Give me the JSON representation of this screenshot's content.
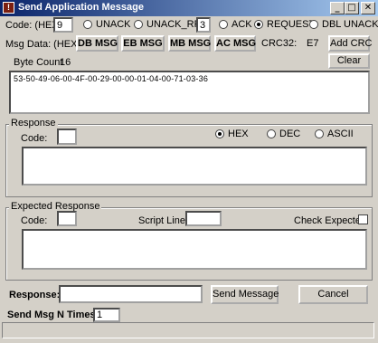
{
  "window": {
    "title": "Send Application Message",
    "app_icon_glyph": "!",
    "minimize_glyph": "_",
    "maximize_glyph": "□",
    "close_glyph": "✕"
  },
  "code": {
    "label": "Code: (HEX)",
    "value": "9"
  },
  "msg_type": {
    "unack": "UNACK",
    "unack_rpt": "UNACK_RPT",
    "rpt_count": "3",
    "ack": "ACK",
    "request": "REQUEST",
    "dbl_unack": "DBL UNACK",
    "selected": "REQUEST"
  },
  "msg_data": {
    "label": "Msg Data: (HEX)",
    "db_msg": "DB MSG",
    "eb_msg": "EB MSG",
    "mb_msg": "MB MSG",
    "ac_msg": "AC MSG",
    "crc_label": "CRC32:",
    "crc_value": "E7",
    "add_crc": "Add CRC",
    "byte_count_label": "Byte Count",
    "byte_count_value": "16",
    "clear": "Clear",
    "data_text": "53-50-49-06-00-4F-00-29-00-00-01-04-00-71-03-36"
  },
  "response_group": {
    "title": "Response",
    "code_label": "Code:",
    "code_value": "",
    "hex": "HEX",
    "dec": "DEC",
    "ascii": "ASCII",
    "selected_format": "HEX",
    "text": ""
  },
  "expected_group": {
    "title": "Expected Response",
    "code_label": "Code:",
    "code_value": "",
    "script_line_label": "Script Line:",
    "script_line_value": "",
    "check_expected_label": "Check Expected",
    "check_expected": false,
    "text": ""
  },
  "bottom": {
    "response_label": "Response:",
    "response_value": "",
    "send_message": "Send Message",
    "cancel": "Cancel",
    "send_n_label": "Send Msg N Times:",
    "send_n_value": "1"
  }
}
